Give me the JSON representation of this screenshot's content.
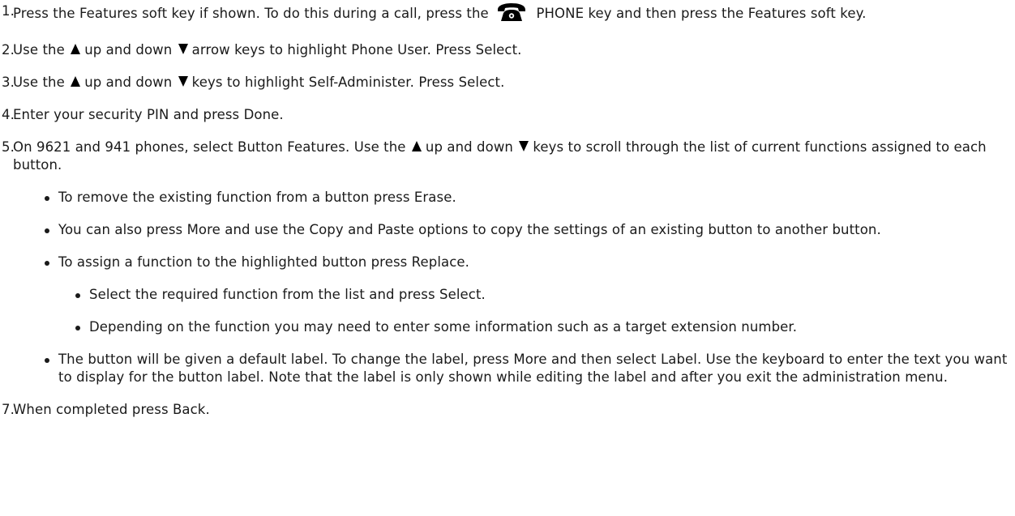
{
  "steps": [
    {
      "num": "1.",
      "segments": [
        {
          "type": "text",
          "value": "Press the Features soft key if shown. To do this during a call, press the "
        },
        {
          "type": "icon",
          "name": "phone-icon"
        },
        {
          "type": "text",
          "value": " PHONE key and then press the Features soft key."
        }
      ]
    },
    {
      "num": "2.",
      "segments": [
        {
          "type": "text",
          "value": "Use the "
        },
        {
          "type": "icon",
          "name": "up-arrow-icon"
        },
        {
          "type": "text",
          "value": "up and down "
        },
        {
          "type": "icon",
          "name": "down-arrow-icon"
        },
        {
          "type": "text",
          "value": "arrow keys to highlight Phone User. Press Select."
        }
      ]
    },
    {
      "num": "3.",
      "segments": [
        {
          "type": "text",
          "value": "Use the "
        },
        {
          "type": "icon",
          "name": "up-arrow-icon"
        },
        {
          "type": "text",
          "value": "up and down "
        },
        {
          "type": "icon",
          "name": "down-arrow-icon"
        },
        {
          "type": "text",
          "value": "keys to highlight Self-Administer. Press Select."
        }
      ]
    },
    {
      "num": "4.",
      "segments": [
        {
          "type": "text",
          "value": "Enter your security PIN and press Done."
        }
      ]
    },
    {
      "num": "5.",
      "segments": [
        {
          "type": "text",
          "value": "On 9621 and 941 phones, select Button Features. Use the "
        },
        {
          "type": "icon",
          "name": "up-arrow-icon"
        },
        {
          "type": "text",
          "value": "up and down "
        },
        {
          "type": "icon",
          "name": "down-arrow-icon"
        },
        {
          "type": "text",
          "value": "keys to scroll through the list of current functions assigned to each button."
        }
      ],
      "bullets": [
        {
          "text": "To remove the existing function from a button press Erase."
        },
        {
          "text": "You can also press More and use the Copy and Paste options to copy the settings of an existing button to another button."
        },
        {
          "text": "To assign a function to the highlighted button press Replace.",
          "subbullets": [
            "Select the required function from the list and press Select.",
            "Depending on the function you may need to enter some information such as a target extension number."
          ]
        },
        {
          "text": "The button will be given a default label. To change the label, press More and then select Label. Use the keyboard to enter the text you want to display for the button label. Note that the label is only shown while editing the label and after you exit the administration menu."
        }
      ]
    },
    {
      "num": "7.",
      "segments": [
        {
          "type": "text",
          "value": "When completed press Back."
        }
      ]
    }
  ]
}
